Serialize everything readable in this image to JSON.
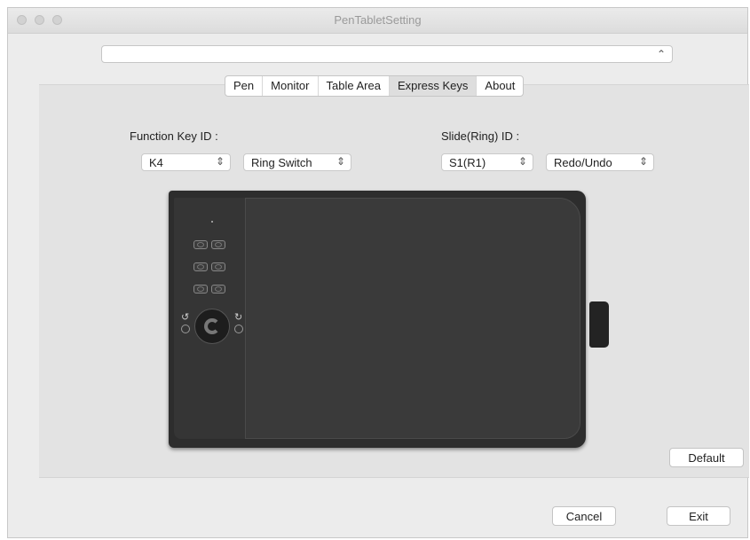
{
  "window": {
    "title": "PenTabletSetting"
  },
  "device_select": {
    "value": ""
  },
  "tabs": [
    {
      "label": "Pen"
    },
    {
      "label": "Monitor"
    },
    {
      "label": "Table Area"
    },
    {
      "label": "Express Keys",
      "active": true
    },
    {
      "label": "About"
    }
  ],
  "express_keys": {
    "function_key_label": "Function Key ID :",
    "function_key_value": "K4",
    "function_key_action": "Ring Switch",
    "slide_label": "Slide(Ring) ID :",
    "slide_value": "S1(R1)",
    "slide_action": "Redo/Undo"
  },
  "buttons": {
    "default": "Default",
    "cancel": "Cancel",
    "exit": "Exit"
  },
  "icons": {
    "updown": "⌃⌄"
  },
  "colors": {
    "window_bg": "#ececec",
    "panel_bg": "#e3e3e3",
    "tablet": "#2d2d2d"
  }
}
